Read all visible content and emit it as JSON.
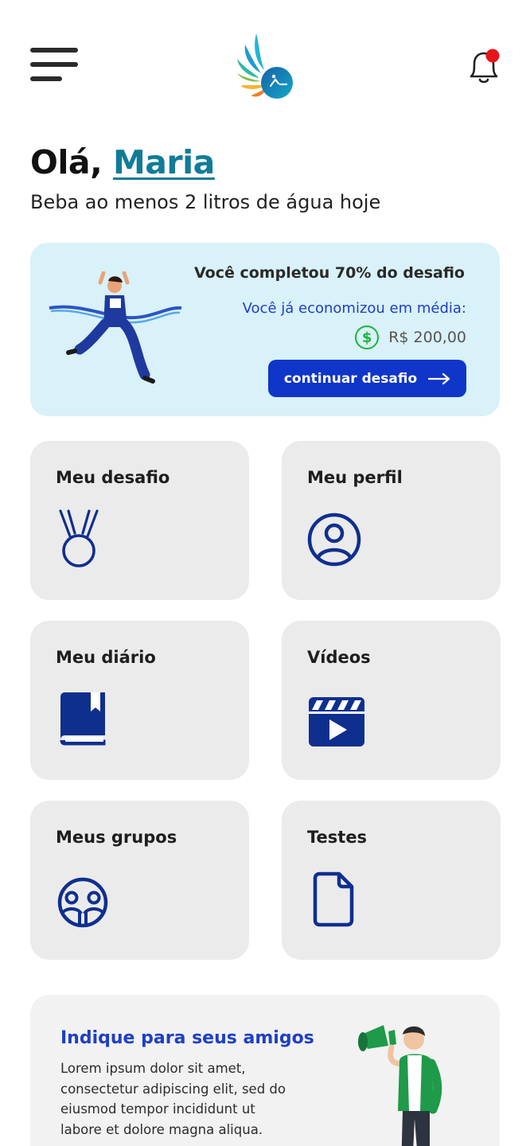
{
  "header": {
    "menu_icon": "hamburger-menu-icon",
    "logo_icon": "wing-logo-icon",
    "bell_icon": "notification-bell-icon",
    "has_notification": true
  },
  "greeting": {
    "prefix": "Olá, ",
    "name": "Maria",
    "subtitle": "Beba ao menos 2 litros de água hoje"
  },
  "challenge": {
    "completed_text": "Você completou 70% do desafio",
    "progress_percent": 70,
    "saved_label": "Você já economizou em média:",
    "currency_icon": "$",
    "amount": "R$ 200,00",
    "cta_label": "continuar desafio"
  },
  "tiles": [
    {
      "label": "Meu desafio",
      "icon": "medal-icon"
    },
    {
      "label": "Meu perfil",
      "icon": "user-circle-icon"
    },
    {
      "label": "Meu diário",
      "icon": "book-icon"
    },
    {
      "label": "Vídeos",
      "icon": "clapperboard-icon"
    },
    {
      "label": "Meus grupos",
      "icon": "group-icon"
    },
    {
      "label": "Testes",
      "icon": "document-icon"
    }
  ],
  "invite": {
    "title": "Indique para seus amigos",
    "body": "Lorem ipsum dolor sit amet, consectetur adipiscing elit, sed do eiusmod tempor incididunt ut labore et dolore magna aliqua."
  },
  "colors": {
    "primary_blue": "#1035c9",
    "teal": "#117c97",
    "icon_navy": "#0f2f8f",
    "card_bg": "#d9f1f8",
    "tile_bg": "#ebebeb",
    "notification_red": "#e8141b",
    "money_green": "#19b53a"
  }
}
